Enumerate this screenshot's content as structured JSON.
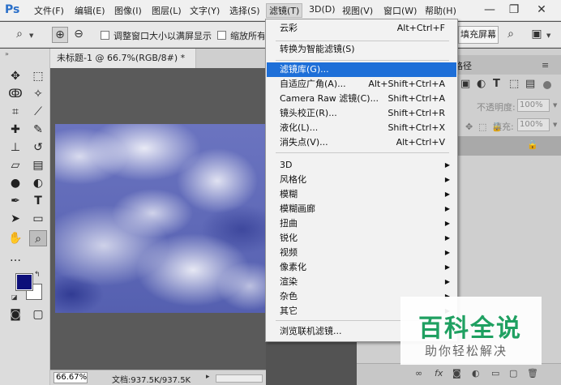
{
  "app": {
    "logo": "Ps"
  },
  "menubar": {
    "items": [
      "文件(F)",
      "编辑(E)",
      "图像(I)",
      "图层(L)",
      "文字(Y)",
      "选择(S)",
      "滤镜(T)",
      "3D(D)",
      "视图(V)",
      "窗口(W)",
      "帮助(H)"
    ],
    "window_controls": {
      "minimize": "—",
      "restore": "❐",
      "close": "✕"
    }
  },
  "options": {
    "resize_windows_label": "调整窗口大小以满屏显示",
    "zoom_all_label": "缩放所有",
    "fill_screen_button": "填充屏幕"
  },
  "document": {
    "tab_title": "未标题-1 @ 66.7%(RGB/8#) *",
    "zoom": "66.67%",
    "doc_size": "文档:937.5K/937.5K",
    "nav_arrow": "▸"
  },
  "right_panel": {
    "tab_paths": "路径",
    "opacity_label": "不透明度:",
    "opacity_value": "100%",
    "fill_label": "填充:",
    "fill_value": "100%",
    "bottom_icons": [
      "link-icon",
      "fx-icon",
      "mask-icon",
      "adjustment-icon",
      "folder-icon",
      "new-layer-icon",
      "trash-icon"
    ]
  },
  "filter_menu": {
    "items": [
      {
        "label": "云彩",
        "shortcut": "Alt+Ctrl+F"
      },
      {
        "label": "转换为智能滤镜(S)",
        "shortcut": ""
      },
      {
        "label": "滤镜库(G)...",
        "shortcut": ""
      },
      {
        "label": "自适应广角(A)...",
        "shortcut": "Alt+Shift+Ctrl+A"
      },
      {
        "label": "Camera Raw 滤镜(C)...",
        "shortcut": "Shift+Ctrl+A"
      },
      {
        "label": "镜头校正(R)...",
        "shortcut": "Shift+Ctrl+R"
      },
      {
        "label": "液化(L)...",
        "shortcut": "Shift+Ctrl+X"
      },
      {
        "label": "消失点(V)...",
        "shortcut": "Alt+Ctrl+V"
      },
      {
        "label": "3D",
        "shortcut": ""
      },
      {
        "label": "风格化",
        "shortcut": ""
      },
      {
        "label": "模糊",
        "shortcut": ""
      },
      {
        "label": "模糊画廊",
        "shortcut": ""
      },
      {
        "label": "扭曲",
        "shortcut": ""
      },
      {
        "label": "锐化",
        "shortcut": ""
      },
      {
        "label": "视频",
        "shortcut": ""
      },
      {
        "label": "像素化",
        "shortcut": ""
      },
      {
        "label": "渲染",
        "shortcut": ""
      },
      {
        "label": "杂色",
        "shortcut": ""
      },
      {
        "label": "其它",
        "shortcut": ""
      },
      {
        "label": "浏览联机滤镜...",
        "shortcut": ""
      }
    ],
    "highlighted": "滤镜库(G)..."
  },
  "colors": {
    "foreground": "#0d0f7a",
    "background": "#ffffff",
    "highlight": "#1e6fd8"
  },
  "watermark": {
    "title": "百科全说",
    "subtitle": "助你轻松解决"
  }
}
